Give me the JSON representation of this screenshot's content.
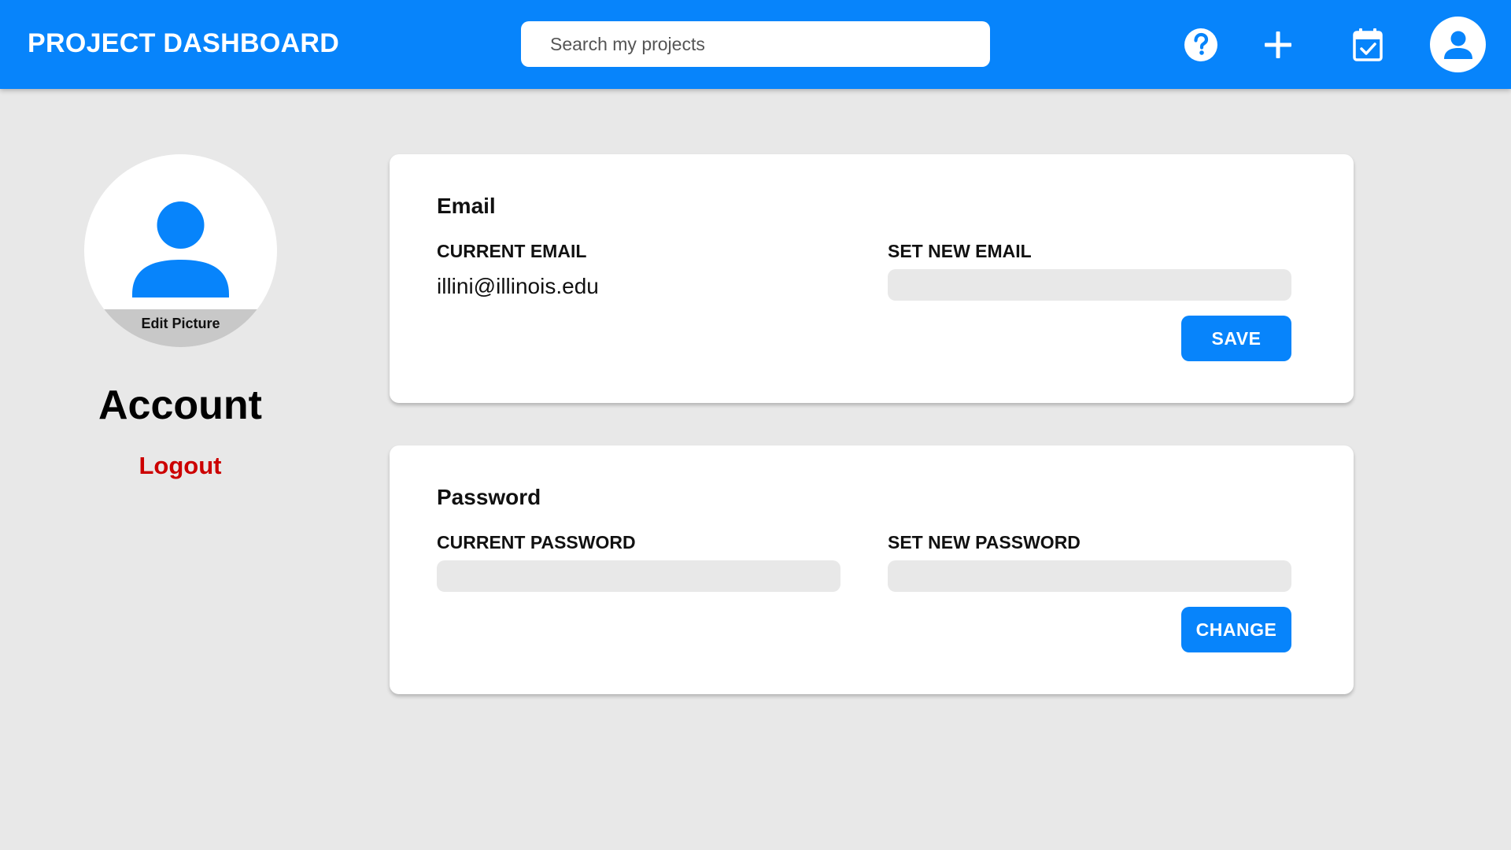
{
  "header": {
    "title": "PROJECT DASHBOARD",
    "search_placeholder": "Search my projects",
    "icons": [
      "help-icon",
      "plus-icon",
      "calendar-check-icon",
      "user-avatar-icon"
    ],
    "brand_color": "#0784fb"
  },
  "sidebar": {
    "edit_picture_label": "Edit Picture",
    "title": "Account",
    "logout_label": "Logout",
    "logout_color": "#cc0000"
  },
  "email_card": {
    "title": "Email",
    "current_label": "CURRENT EMAIL",
    "current_value": "illini@illinois.edu",
    "new_label": "SET NEW EMAIL",
    "new_value": "",
    "button_label": "SAVE"
  },
  "password_card": {
    "title": "Password",
    "current_label": "CURRENT PASSWORD",
    "current_value": "",
    "new_label": "SET NEW PASSWORD",
    "new_value": "",
    "button_label": "CHANGE"
  }
}
